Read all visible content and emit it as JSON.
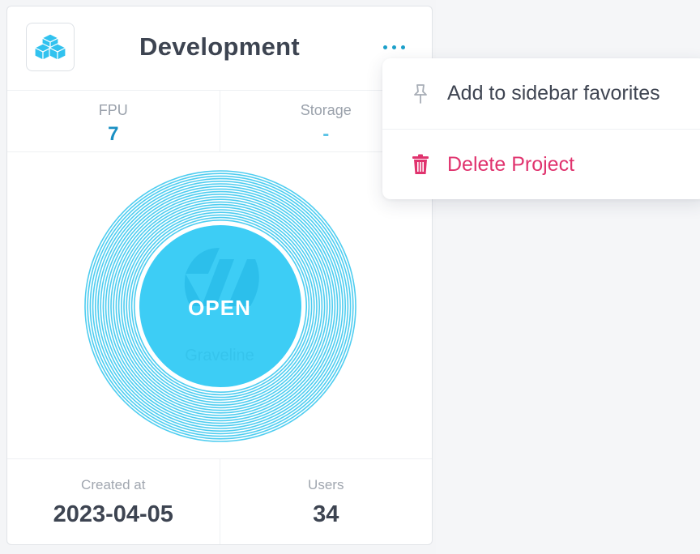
{
  "card": {
    "title": "Development",
    "logo_icon": "cubes-icon",
    "more_icon": "more-dots-icon",
    "stats": [
      {
        "label": "FPU",
        "value": "7"
      },
      {
        "label": "Storage",
        "value": "-"
      }
    ],
    "open_label": "OPEN",
    "watermark": "Graveline",
    "footer": [
      {
        "label": "Created at",
        "value": "2023-04-05"
      },
      {
        "label": "Users",
        "value": "34"
      }
    ]
  },
  "menu": {
    "items": [
      {
        "label": "Add to sidebar favorites",
        "icon": "pin-icon"
      },
      {
        "label": "Delete Project",
        "icon": "trash-icon"
      }
    ]
  },
  "colors": {
    "accent": "#1a9fc9",
    "ring": "#3cc8ee",
    "danger": "#e0336e",
    "text": "#3d4451"
  }
}
